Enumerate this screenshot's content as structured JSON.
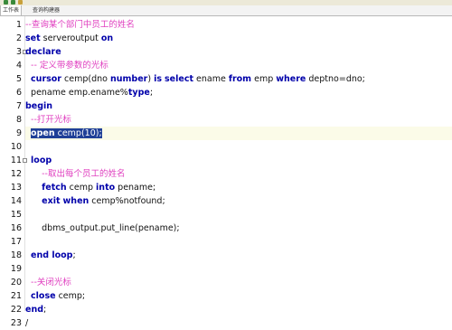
{
  "tabs": [
    "工作表",
    "查询构建器"
  ],
  "colors": {
    "keyword": "#0000aa",
    "comment": "#e040c0",
    "selection": "#1f3f97"
  },
  "lines": [
    {
      "n": "1",
      "tokens": [
        {
          "t": "--查询某个部门中员工的姓名",
          "c": "cmt"
        }
      ]
    },
    {
      "n": "2",
      "tokens": [
        {
          "t": "set",
          "c": "kw"
        },
        {
          "t": " serveroutput ",
          "c": ""
        },
        {
          "t": "on",
          "c": "kw"
        }
      ]
    },
    {
      "n": "3",
      "tokens": [
        {
          "t": "declare",
          "c": "kw"
        }
      ]
    },
    {
      "n": "4",
      "tokens": [
        {
          "t": "  -- 定义带参数的光标",
          "c": "cmt"
        }
      ]
    },
    {
      "n": "5",
      "tokens": [
        {
          "t": "  ",
          "c": ""
        },
        {
          "t": "cursor",
          "c": "kw"
        },
        {
          "t": " cemp(dno ",
          "c": ""
        },
        {
          "t": "number",
          "c": "kw"
        },
        {
          "t": ") ",
          "c": ""
        },
        {
          "t": "is",
          "c": "kw"
        },
        {
          "t": " ",
          "c": ""
        },
        {
          "t": "select",
          "c": "kw"
        },
        {
          "t": " ename ",
          "c": ""
        },
        {
          "t": "from",
          "c": "kw"
        },
        {
          "t": " emp ",
          "c": ""
        },
        {
          "t": "where",
          "c": "kw"
        },
        {
          "t": " deptno=dno;",
          "c": ""
        }
      ]
    },
    {
      "n": "6",
      "tokens": [
        {
          "t": "  pename emp.ename%",
          "c": ""
        },
        {
          "t": "type",
          "c": "kw"
        },
        {
          "t": ";",
          "c": ""
        }
      ]
    },
    {
      "n": "7",
      "tokens": [
        {
          "t": "begin",
          "c": "kw"
        }
      ]
    },
    {
      "n": "8",
      "tokens": [
        {
          "t": "  --打开光标",
          "c": "cmt"
        }
      ]
    },
    {
      "n": "9",
      "tokens": [
        {
          "t": "  ",
          "c": ""
        },
        {
          "t": "open",
          "c": "kw sel"
        },
        {
          "t": " cemp(10);",
          "c": "sel"
        }
      ]
    },
    {
      "n": "10",
      "tokens": []
    },
    {
      "n": "11",
      "tokens": [
        {
          "t": "  ",
          "c": ""
        },
        {
          "t": "loop",
          "c": "kw"
        }
      ]
    },
    {
      "n": "12",
      "tokens": [
        {
          "t": "      --取出每个员工的姓名",
          "c": "cmt"
        }
      ]
    },
    {
      "n": "13",
      "tokens": [
        {
          "t": "      ",
          "c": ""
        },
        {
          "t": "fetch",
          "c": "kw"
        },
        {
          "t": " cemp ",
          "c": ""
        },
        {
          "t": "into",
          "c": "kw"
        },
        {
          "t": " pename;",
          "c": ""
        }
      ]
    },
    {
      "n": "14",
      "tokens": [
        {
          "t": "      ",
          "c": ""
        },
        {
          "t": "exit",
          "c": "kw"
        },
        {
          "t": " ",
          "c": ""
        },
        {
          "t": "when",
          "c": "kw"
        },
        {
          "t": " cemp%notfound;",
          "c": ""
        }
      ]
    },
    {
      "n": "15",
      "tokens": []
    },
    {
      "n": "16",
      "tokens": [
        {
          "t": "      dbms_output.put_line(pename);",
          "c": ""
        }
      ]
    },
    {
      "n": "17",
      "tokens": []
    },
    {
      "n": "18",
      "tokens": [
        {
          "t": "  ",
          "c": ""
        },
        {
          "t": "end loop",
          "c": "kw"
        },
        {
          "t": ";",
          "c": ""
        }
      ]
    },
    {
      "n": "19",
      "tokens": []
    },
    {
      "n": "20",
      "tokens": [
        {
          "t": "  --关闭光标",
          "c": "cmt"
        }
      ]
    },
    {
      "n": "21",
      "tokens": [
        {
          "t": "  ",
          "c": ""
        },
        {
          "t": "close",
          "c": "kw"
        },
        {
          "t": " cemp;",
          "c": ""
        }
      ]
    },
    {
      "n": "22",
      "tokens": [
        {
          "t": "end",
          "c": "kw"
        },
        {
          "t": ";",
          "c": ""
        }
      ]
    },
    {
      "n": "23",
      "tokens": [
        {
          "t": "/",
          "c": ""
        }
      ]
    }
  ]
}
